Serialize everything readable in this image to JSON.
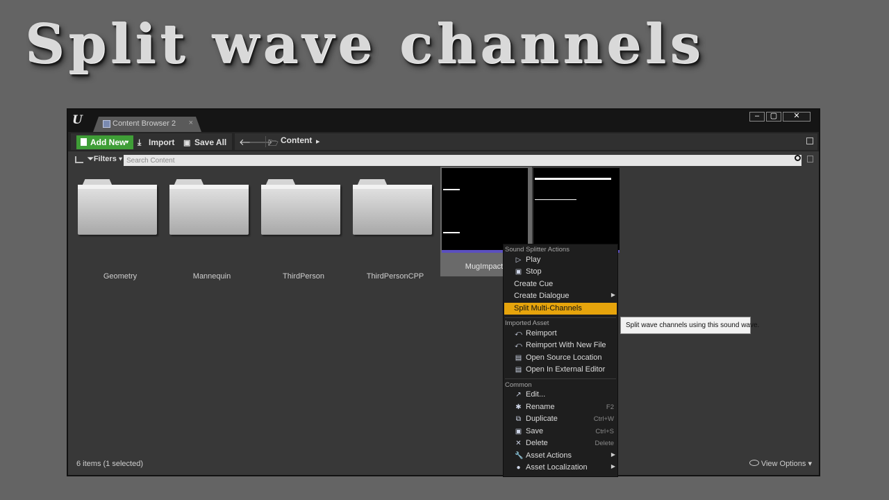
{
  "headline": "Split wave channels",
  "window": {
    "tab_label": "Content Browser 2",
    "tab_close": "×",
    "controls": {
      "minimize": "–",
      "maximize": "▢",
      "close": "✕"
    }
  },
  "toolbar": {
    "add_new": "Add New",
    "import": "Import",
    "save_all": "Save All",
    "back_arrow": "🡐",
    "forward_arrow": "🡒",
    "path": "Content",
    "path_arrow": "▸"
  },
  "filters": {
    "label": "Filters",
    "search_placeholder": "Search Content"
  },
  "assets": [
    {
      "label": "Geometry",
      "kind": "folder"
    },
    {
      "label": "Mannequin",
      "kind": "folder"
    },
    {
      "label": "ThirdPerson",
      "kind": "folder"
    },
    {
      "label": "ThirdPersonCPP",
      "kind": "folder"
    },
    {
      "label": "MugImpact",
      "kind": "soundwave",
      "selected": true
    },
    {
      "label": "",
      "kind": "soundwave"
    }
  ],
  "status_text": "6 items (1 selected)",
  "view_options": "View Options",
  "context_menu": {
    "sections": [
      {
        "heading": "Sound Splitter Actions",
        "items": [
          {
            "label": "Play",
            "icon": "play-icon"
          },
          {
            "label": "Stop",
            "icon": "stop-icon"
          },
          {
            "label": "Create Cue"
          },
          {
            "label": "Create Dialogue",
            "submenu": true
          },
          {
            "label": "Split Multi-Channels",
            "highlighted": true
          }
        ]
      },
      {
        "heading": "Imported Asset",
        "items": [
          {
            "label": "Reimport",
            "icon": "reimport-icon"
          },
          {
            "label": "Reimport With New File",
            "icon": "reimport-new-icon"
          },
          {
            "label": "Open Source Location",
            "icon": "folder-location-icon"
          },
          {
            "label": "Open In External Editor",
            "icon": "external-editor-icon"
          }
        ]
      },
      {
        "heading": "Common",
        "items": [
          {
            "label": "Edit...",
            "icon": "edit-icon"
          },
          {
            "label": "Rename",
            "icon": "rename-icon",
            "shortcut": "F2"
          },
          {
            "label": "Duplicate",
            "icon": "duplicate-icon",
            "shortcut": "Ctrl+W"
          },
          {
            "label": "Save",
            "icon": "save-icon",
            "shortcut": "Ctrl+S"
          },
          {
            "label": "Delete",
            "icon": "delete-icon",
            "shortcut": "Delete"
          },
          {
            "label": "Asset Actions",
            "icon": "wrench-icon",
            "submenu": true
          },
          {
            "label": "Asset Localization",
            "icon": "globe-icon",
            "submenu": true
          }
        ]
      }
    ]
  },
  "tooltip": "Split wave channels using this sound wave.",
  "colors": {
    "accent_highlight": "#e6a40c",
    "add_new_green": "#3f9e37",
    "wave_bar": "#5b4fc0"
  }
}
